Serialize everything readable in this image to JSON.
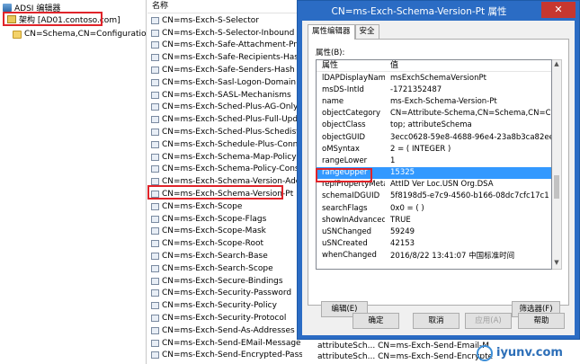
{
  "tree": {
    "root_label": "ADSI 编辑器",
    "schema_label": "架构 [AD01.contoso.com]",
    "schema_child_label": "CN=Schema,CN=Configuration,DC="
  },
  "list": {
    "header": "名称",
    "items": [
      "CN=ms-Exch-S-Selector",
      "CN=ms-Exch-S-Selector-Inbound",
      "CN=ms-Exch-Safe-Attachment-Protectio",
      "CN=ms-Exch-Safe-Recipients-Hash",
      "CN=ms-Exch-Safe-Senders-Hash",
      "CN=ms-Exch-Sasl-Logon-Domain",
      "CN=ms-Exch-SASL-Mechanisms",
      "CN=ms-Exch-Sched-Plus-AG-Only",
      "CN=ms-Exch-Sched-Plus-Full-Update",
      "CN=ms-Exch-Sched-Plus-Schedist",
      "CN=ms-Exch-Schedule-Plus-Connector",
      "CN=ms-Exch-Schema-Map-Policy",
      "CN=ms-Exch-Schema-Policy-Consumers",
      "CN=ms-Exch-Schema-Version-Adc",
      "CN=ms-Exch-Schema-Version-Pt",
      "CN=ms-Exch-Scope",
      "CN=ms-Exch-Scope-Flags",
      "CN=ms-Exch-Scope-Mask",
      "CN=ms-Exch-Scope-Root",
      "CN=ms-Exch-Search-Base",
      "CN=ms-Exch-Search-Scope",
      "CN=ms-Exch-Secure-Bindings",
      "CN=ms-Exch-Security-Password",
      "CN=ms-Exch-Security-Policy",
      "CN=ms-Exch-Security-Protocol",
      "CN=ms-Exch-Send-As-Addresses",
      "CN=ms-Exch-Send-EMail-Message",
      "CN=ms-Exch-Send-Encrypted-Password"
    ],
    "behind_row1": "attributeSch...  CN=ms-Exch-Send-Email-M",
    "behind_row2": "attributeSch...  CN=ms-Exch-Send-Encrypte"
  },
  "dialog": {
    "title": "CN=ms-Exch-Schema-Version-Pt 属性",
    "close_glyph": "✕",
    "tabs": [
      "属性编辑器",
      "安全"
    ],
    "props_label": "属性(B):",
    "col_attr": "属性",
    "col_value": "值",
    "rows": [
      {
        "attr": "lDAPDisplayName",
        "value": "msExchSchemaVersionPt"
      },
      {
        "attr": "msDS-IntId",
        "value": "-1721352487"
      },
      {
        "attr": "name",
        "value": "ms-Exch-Schema-Version-Pt"
      },
      {
        "attr": "objectCategory",
        "value": "CN=Attribute-Schema,CN=Schema,CN=Configu"
      },
      {
        "attr": "objectClass",
        "value": "top; attributeSchema"
      },
      {
        "attr": "objectGUID",
        "value": "3ecc0628-59e8-4688-96e4-23a8b3ca82ee"
      },
      {
        "attr": "oMSyntax",
        "value": "2 = ( INTEGER )"
      },
      {
        "attr": "rangeLower",
        "value": "1"
      },
      {
        "attr": "rangeUpper",
        "value": "15325"
      },
      {
        "attr": "replPropertyMeta...",
        "value": "AttID  Ver    Loc.USN           Org.DSA"
      },
      {
        "attr": "schemaIDGUID",
        "value": "5f8198d5-e7c9-4560-b166-08dc7cfc17c1"
      },
      {
        "attr": "searchFlags",
        "value": "0x0 = ( )"
      },
      {
        "attr": "showInAdvanced...",
        "value": "TRUE"
      },
      {
        "attr": "uSNChanged",
        "value": "59249"
      },
      {
        "attr": "uSNCreated",
        "value": "42153"
      },
      {
        "attr": "whenChanged",
        "value": "2016/8/22 13:41:07 中国标准时间"
      }
    ],
    "selected_row_index": 8,
    "scroll_up": "▲",
    "scroll_down": "▼",
    "edit_button": "编辑(E)",
    "filter_button": "筛选器(F)",
    "ok_button": "确定",
    "cancel_button": "取消",
    "apply_button": "应用(A)",
    "help_button": "帮助"
  },
  "watermark": {
    "text": "iyunv.com"
  },
  "colors": {
    "dialog_frame": "#2b6cc4",
    "close_button": "#c7372f",
    "selection": "#3399ff",
    "highlight_box": "#e0242a"
  }
}
